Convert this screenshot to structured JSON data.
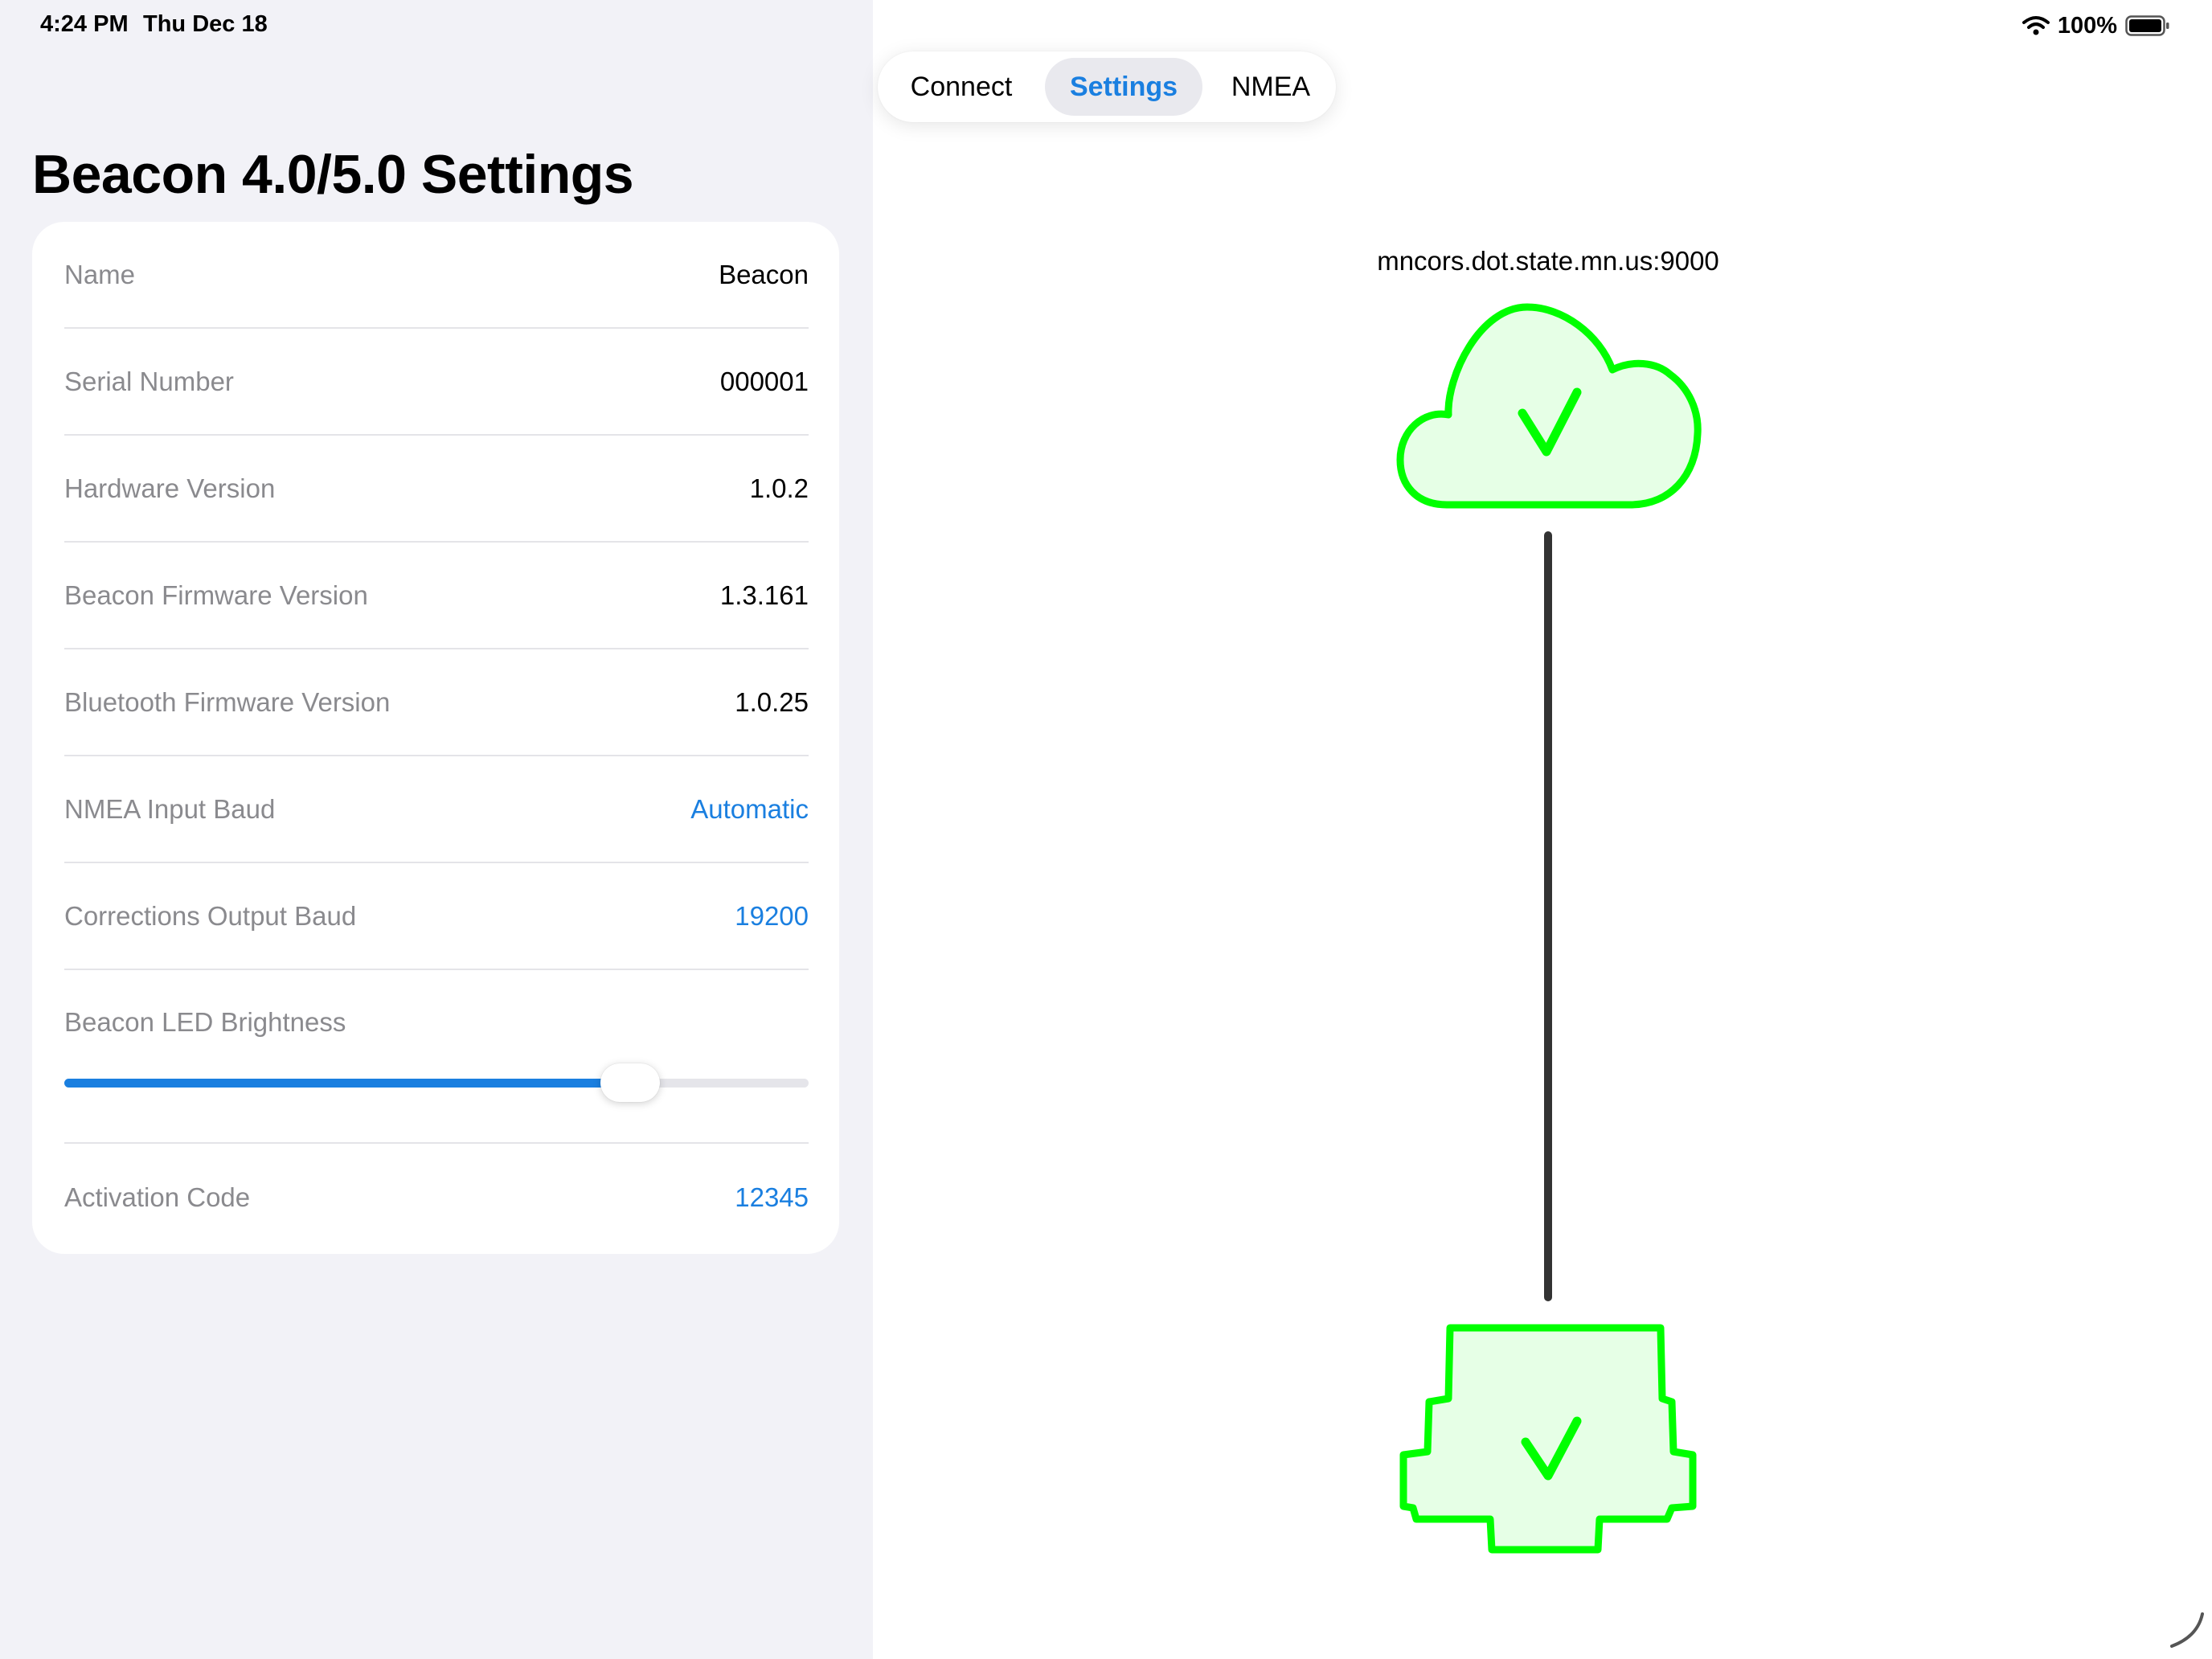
{
  "status_bar": {
    "time": "4:24 PM",
    "date": "Thu Dec 18",
    "battery": "100%",
    "icons": [
      "wifi-icon",
      "battery-icon"
    ]
  },
  "settings": {
    "title": "Beacon 4.0/5.0 Settings",
    "rows": [
      {
        "label": "Name",
        "value": "Beacon"
      },
      {
        "label": "Serial Number",
        "value": "000001"
      },
      {
        "label": "Hardware Version",
        "value": "1.0.2"
      },
      {
        "label": "Beacon Firmware Version",
        "value": "1.3.161"
      },
      {
        "label": "Bluetooth Firmware Version",
        "value": "1.0.25"
      },
      {
        "label": "NMEA Input Baud",
        "value": "Automatic"
      },
      {
        "label": "Corrections Output Baud",
        "value": "19200"
      }
    ],
    "led_brightness": {
      "label": "Beacon LED Brightness",
      "value_fraction": 0.76
    },
    "activation": {
      "label": "Activation Code",
      "value": "12345"
    }
  },
  "tabs": {
    "items": [
      "Connect",
      "Settings",
      "NMEA"
    ],
    "selected": "Settings"
  },
  "connection": {
    "server": "mncors.dot.state.mn.us:9000",
    "cloud_status_icon": "cloud-check-icon",
    "device_status_icon": "device-check-icon"
  },
  "colors": {
    "accent": "#1a7fe0",
    "status_ok_stroke": "#00ff00",
    "status_ok_fill": "#e6ffe6",
    "link_line": "#333333",
    "sidebar_bg": "#f2f2f7"
  }
}
